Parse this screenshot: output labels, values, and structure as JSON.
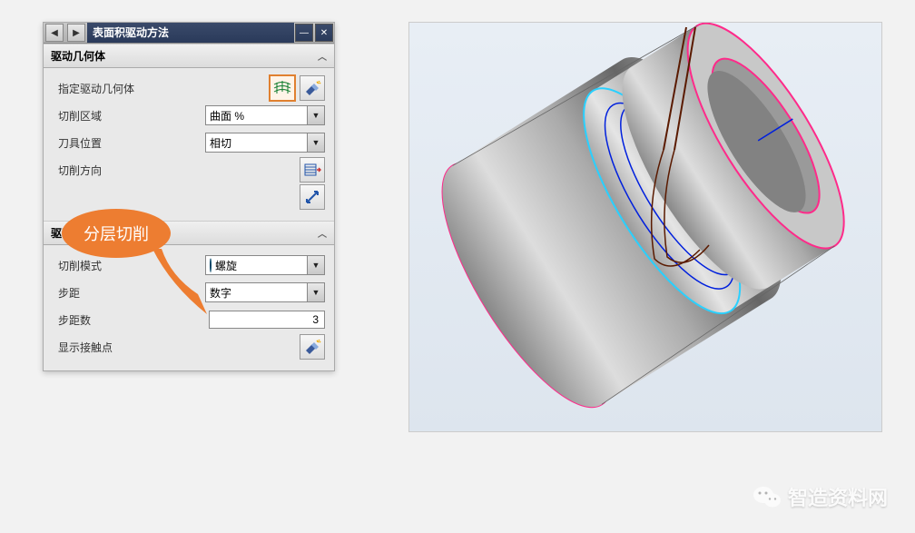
{
  "dialog": {
    "title": "表面积驱动方法",
    "nav_prev": "◀",
    "nav_next": "▶",
    "minimize": "—",
    "close": "✕",
    "sections": {
      "geom": {
        "header": "驱动几何体",
        "specify_label": "指定驱动几何体",
        "region_label": "切削区域",
        "region_value": "曲面 %",
        "tool_pos_label": "刀具位置",
        "tool_pos_value": "相切",
        "cut_dir_label": "切削方向"
      },
      "settings": {
        "header": "驱动设置",
        "mode_label": "切削模式",
        "mode_value": "螺旋",
        "step_label": "步距",
        "step_value": "数字",
        "step_count_label": "步距数",
        "step_count_value": "3",
        "contact_label": "显示接触点"
      }
    }
  },
  "callout": {
    "text": "分层切削"
  },
  "watermark": {
    "text": "智造资料网"
  }
}
